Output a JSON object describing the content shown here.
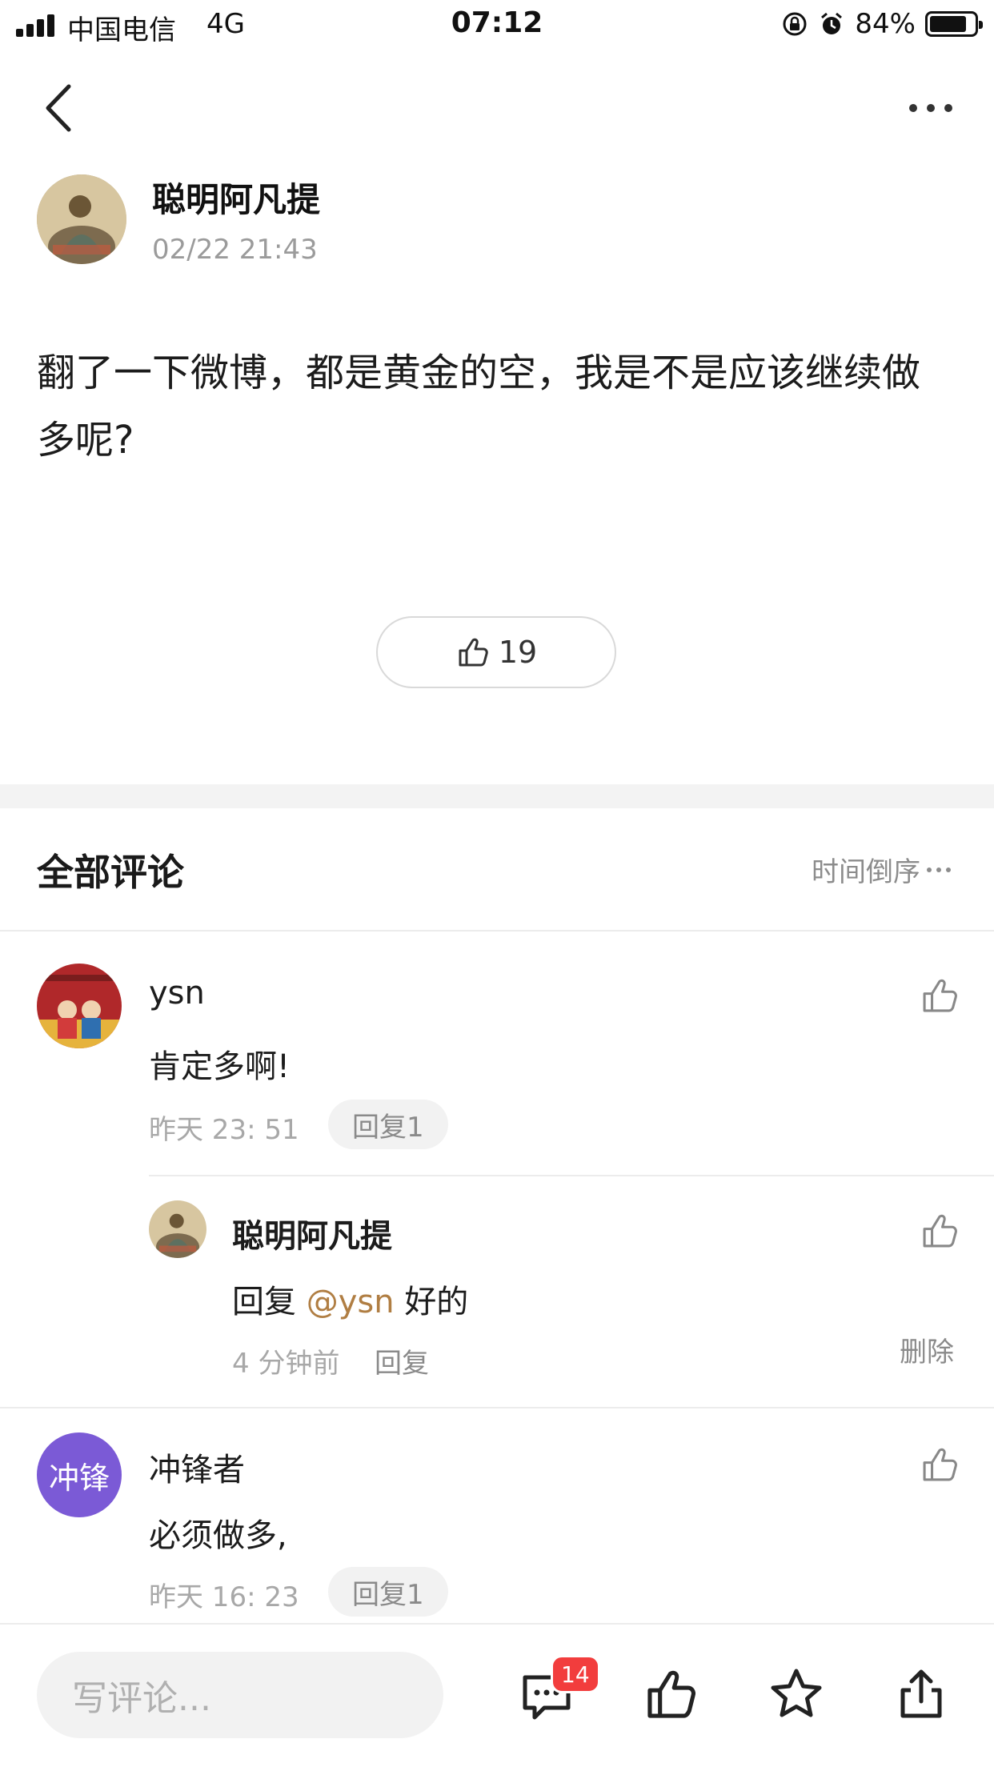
{
  "status_bar": {
    "carrier": "中国电信",
    "network": "4G",
    "time": "07:12",
    "battery": "84%",
    "battery_level": 0.84
  },
  "post": {
    "author": "聪明阿凡提",
    "timestamp": "02/22 21:43",
    "body": "翻了一下微博，都是黄金的空，我是不是应该继续做多呢?",
    "like_count": "19"
  },
  "comments_section": {
    "title": "全部评论",
    "sort_label": "时间倒序",
    "comments": [
      {
        "author": "ysn",
        "text": "肯定多啊!",
        "time": "昨天 23: 51",
        "reply_chip": "回复1",
        "replies": [
          {
            "author": "聪明阿凡提",
            "reply_prefix": "回复",
            "mention": "@ysn",
            "text": "好的",
            "time": "4 分钟前",
            "reply_label": "回复",
            "delete_label": "删除"
          }
        ]
      },
      {
        "author": "冲锋者",
        "avatar_text": "冲锋",
        "avatar_color": "#7b5ad6",
        "text": "必须做多,",
        "time": "昨天 16: 23",
        "reply_chip": "回复1"
      }
    ]
  },
  "bottom_bar": {
    "input_placeholder": "写评论...",
    "comment_badge": "14"
  },
  "colors": {
    "mention": "#b07e43",
    "badge": "#f23d3d"
  }
}
